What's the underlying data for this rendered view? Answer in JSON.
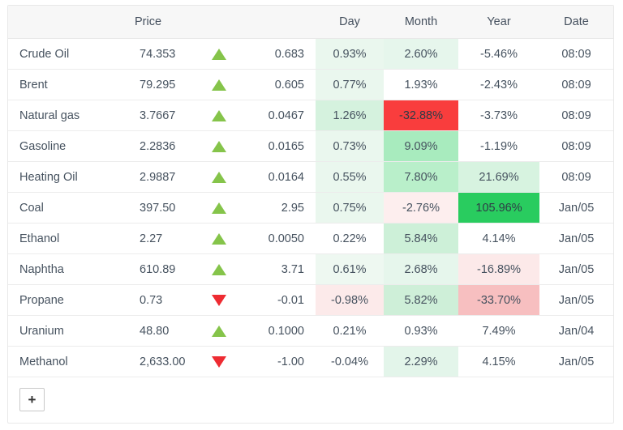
{
  "table": {
    "columns": [
      {
        "key": "name",
        "label": "",
        "align": "left"
      },
      {
        "key": "price",
        "label": "Price",
        "align": "left"
      },
      {
        "key": "arrow",
        "label": "",
        "align": "right"
      },
      {
        "key": "change",
        "label": "",
        "align": "right"
      },
      {
        "key": "day",
        "label": "Day",
        "align": "center"
      },
      {
        "key": "month",
        "label": "Month",
        "align": "center"
      },
      {
        "key": "year",
        "label": "Year",
        "align": "center"
      },
      {
        "key": "date",
        "label": "Date",
        "align": "center"
      }
    ],
    "rows": [
      {
        "name": "Crude Oil",
        "price": "74.353",
        "direction": "up",
        "change": "0.683",
        "day": "0.93%",
        "month": "2.60%",
        "year": "-5.46%",
        "date": "08:09",
        "day_bg": "#eaf7ee",
        "month_bg": "#e6f6ec",
        "year_bg": "#ffffff"
      },
      {
        "name": "Brent",
        "price": "79.295",
        "direction": "up",
        "change": "0.605",
        "day": "0.77%",
        "month": "1.93%",
        "year": "-2.43%",
        "date": "08:09",
        "day_bg": "#eaf7ee",
        "month_bg": "#ffffff",
        "year_bg": "#ffffff"
      },
      {
        "name": "Natural gas",
        "price": "3.7667",
        "direction": "up",
        "change": "0.0467",
        "day": "1.26%",
        "month": "-32.88%",
        "year": "-3.73%",
        "date": "08:09",
        "day_bg": "#d5f2de",
        "month_bg": "#f93d3d",
        "year_bg": "#ffffff"
      },
      {
        "name": "Gasoline",
        "price": "2.2836",
        "direction": "up",
        "change": "0.0165",
        "day": "0.73%",
        "month": "9.09%",
        "year": "-1.19%",
        "date": "08:09",
        "day_bg": "#eaf7ee",
        "month_bg": "#a8ebbe",
        "year_bg": "#ffffff"
      },
      {
        "name": "Heating Oil",
        "price": "2.9887",
        "direction": "up",
        "change": "0.0164",
        "day": "0.55%",
        "month": "7.80%",
        "year": "21.69%",
        "date": "08:09",
        "day_bg": "#eaf7ee",
        "month_bg": "#b9efca",
        "year_bg": "#d7f3e0"
      },
      {
        "name": "Coal",
        "price": "397.50",
        "direction": "up",
        "change": "2.95",
        "day": "0.75%",
        "month": "-2.76%",
        "year": "105.96%",
        "date": "Jan/05",
        "day_bg": "#eaf7ee",
        "month_bg": "#fdeeee",
        "year_bg": "#29cc5f"
      },
      {
        "name": "Ethanol",
        "price": "2.27",
        "direction": "up",
        "change": "0.0050",
        "day": "0.22%",
        "month": "5.84%",
        "year": "4.14%",
        "date": "Jan/05",
        "day_bg": "#ffffff",
        "month_bg": "#cdf0d8",
        "year_bg": "#ffffff"
      },
      {
        "name": "Naphtha",
        "price": "610.89",
        "direction": "up",
        "change": "3.71",
        "day": "0.61%",
        "month": "2.68%",
        "year": "-16.89%",
        "date": "Jan/05",
        "day_bg": "#eef8f1",
        "month_bg": "#e6f6ec",
        "year_bg": "#fce9e9"
      },
      {
        "name": "Propane",
        "price": "0.73",
        "direction": "down",
        "change": "-0.01",
        "day": "-0.98%",
        "month": "5.82%",
        "year": "-33.70%",
        "date": "Jan/05",
        "day_bg": "#fceaea",
        "month_bg": "#ceefd8",
        "year_bg": "#f7bfc0"
      },
      {
        "name": "Uranium",
        "price": "48.80",
        "direction": "up",
        "change": "0.1000",
        "day": "0.21%",
        "month": "0.93%",
        "year": "7.49%",
        "date": "Jan/04",
        "day_bg": "#ffffff",
        "month_bg": "#ffffff",
        "year_bg": "#ffffff"
      },
      {
        "name": "Methanol",
        "price": "2,633.00",
        "direction": "down",
        "change": "-1.00",
        "day": "-0.04%",
        "month": "2.29%",
        "year": "4.15%",
        "date": "Jan/05",
        "day_bg": "#ffffff",
        "month_bg": "#e3f5ea",
        "year_bg": "#ffffff"
      }
    ],
    "add_button_label": "+"
  },
  "colors": {
    "header_bg": "#f7f7f7",
    "border": "#e8e8e8",
    "text": "#46525f",
    "up_arrow": "#85c44a",
    "down_arrow": "#ee2b32",
    "positive_text": "#3f6b4b"
  }
}
